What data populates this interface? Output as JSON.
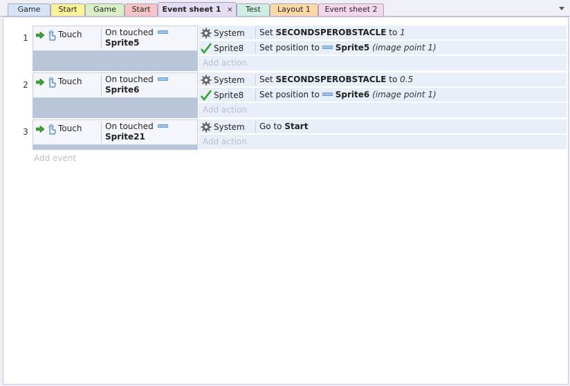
{
  "tabs": [
    {
      "label": "Game",
      "color": "#d6e4f7",
      "active": false
    },
    {
      "label": "Start",
      "color": "#fbf29a",
      "active": false
    },
    {
      "label": "Game",
      "color": "#d9f0c6",
      "active": false
    },
    {
      "label": "Start",
      "color": "#f6c4c4",
      "active": false
    },
    {
      "label": "Event sheet 1",
      "color": "#e3dcf3",
      "active": true,
      "close": "×"
    },
    {
      "label": "Test",
      "color": "#cfeee2",
      "active": false
    },
    {
      "label": "Layout 1",
      "color": "#fbd8a6",
      "active": false
    },
    {
      "label": "Event sheet 2",
      "color": "#f4d7ea",
      "active": false
    }
  ],
  "events": [
    {
      "number": "1",
      "condition": {
        "object": "Touch",
        "text": "On touched",
        "param": "Sprite5"
      },
      "actions": [
        {
          "object": "System",
          "icon": "gear-icon",
          "pre": "Set ",
          "bold": "SECONDSPEROBSTACLE",
          "mid": " to ",
          "italic": "1"
        },
        {
          "object": "Sprite8",
          "icon": "checkmark-icon",
          "pre": "Set position to ",
          "bold": "Sprite5",
          "mid": " ",
          "italic": "(image point 1)",
          "param_icon": true
        }
      ],
      "add_action": "Add action"
    },
    {
      "number": "2",
      "condition": {
        "object": "Touch",
        "text": "On touched",
        "param": "Sprite6"
      },
      "actions": [
        {
          "object": "System",
          "icon": "gear-icon",
          "pre": "Set ",
          "bold": "SECONDSPEROBSTACLE",
          "mid": " to ",
          "italic": "0.5"
        },
        {
          "object": "Sprite8",
          "icon": "checkmark-icon",
          "pre": "Set position to ",
          "bold": "Sprite6",
          "mid": " ",
          "italic": "(image point 1)",
          "param_icon": true
        }
      ],
      "add_action": "Add action"
    },
    {
      "number": "3",
      "condition": {
        "object": "Touch",
        "text": "On touched",
        "param": "Sprite21"
      },
      "actions": [
        {
          "object": "System",
          "icon": "gear-icon",
          "pre": "Go to ",
          "bold": "Start",
          "mid": "",
          "italic": ""
        }
      ],
      "add_action": "Add action"
    }
  ],
  "add_event": "Add event"
}
